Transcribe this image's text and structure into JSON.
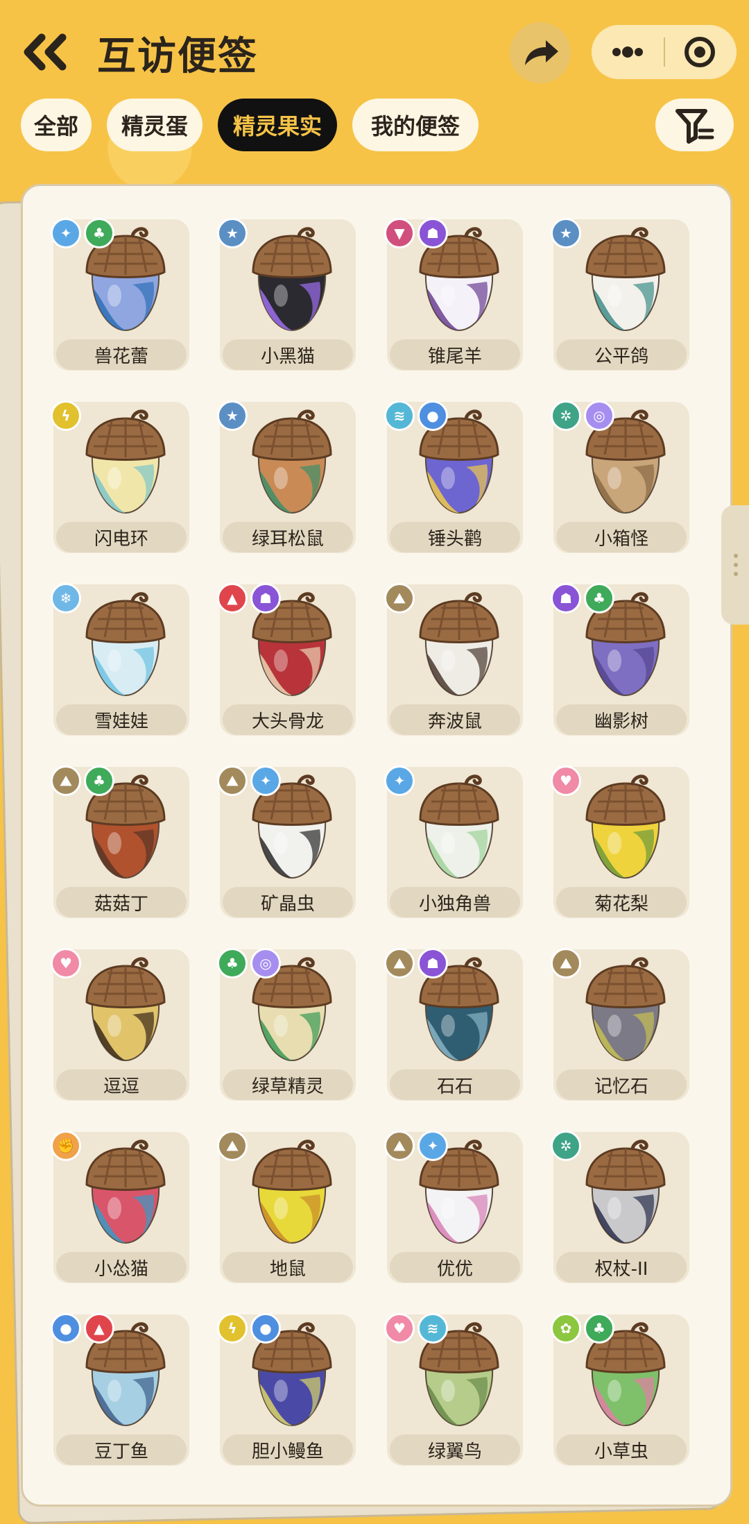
{
  "header": {
    "title": "互访便签",
    "back_icon": "double-chevron-left-icon",
    "share_icon": "share-arrow-icon",
    "more_icon": "more-dots-icon",
    "close_icon": "target-close-icon"
  },
  "tabs": [
    {
      "label": "全部",
      "active": false
    },
    {
      "label": "精灵蛋",
      "active": false
    },
    {
      "label": "精灵果实",
      "active": true
    },
    {
      "label": "我的便签",
      "active": false
    }
  ],
  "filter_icon": "filter-funnel-icon",
  "colors": {
    "background": "#f6c347",
    "active_tab_bg": "#111111",
    "active_tab_text": "#f6c347",
    "acorn_cap": "#9a6b42"
  },
  "fruits": [
    {
      "name": "兽花蕾",
      "types": [
        "ice",
        "grass"
      ],
      "body": [
        "#8fa6e0",
        "#2f6fb7"
      ]
    },
    {
      "name": "小黑猫",
      "types": [
        "normal"
      ],
      "body": [
        "#2a2a30",
        "#9e6ff0"
      ]
    },
    {
      "name": "锥尾羊",
      "types": [
        "demon",
        "ghost"
      ],
      "body": [
        "#f4f1f8",
        "#6b3f93"
      ]
    },
    {
      "name": "公平鸽",
      "types": [
        "normal"
      ],
      "body": [
        "#f3f1ec",
        "#3f8e8a"
      ]
    },
    {
      "name": "闪电环",
      "types": [
        "electric"
      ],
      "body": [
        "#f1e6a9",
        "#7ec6c9"
      ]
    },
    {
      "name": "绿耳松鼠",
      "types": [
        "normal"
      ],
      "body": [
        "#c98a55",
        "#3e8f6a"
      ]
    },
    {
      "name": "锤头鹳",
      "types": [
        "wing",
        "water"
      ],
      "body": [
        "#6d66d0",
        "#f0c94a"
      ]
    },
    {
      "name": "小箱怪",
      "types": [
        "mech",
        "illusion"
      ],
      "body": [
        "#c9a57a",
        "#8a6a44"
      ]
    },
    {
      "name": "雪娃娃",
      "types": [
        "frost"
      ],
      "body": [
        "#d8ecf3",
        "#6fc3e3"
      ]
    },
    {
      "name": "大头骨龙",
      "types": [
        "fire",
        "ghost"
      ],
      "body": [
        "#b8343a",
        "#e9d3b3"
      ]
    },
    {
      "name": "奔波鼠",
      "types": [
        "ground"
      ],
      "body": [
        "#efece6",
        "#4a3a30"
      ]
    },
    {
      "name": "幽影树",
      "types": [
        "ghost",
        "grass"
      ],
      "body": [
        "#7e6fc2",
        "#54468e"
      ]
    },
    {
      "name": "菇菇丁",
      "types": [
        "ground",
        "grass"
      ],
      "body": [
        "#b0522e",
        "#5a3526"
      ]
    },
    {
      "name": "矿晶虫",
      "types": [
        "ground",
        "ice"
      ],
      "body": [
        "#f1f1ee",
        "#2a2a2a"
      ]
    },
    {
      "name": "小独角兽",
      "types": [
        "ice"
      ],
      "body": [
        "#eef1ea",
        "#9fd39a"
      ]
    },
    {
      "name": "菊花梨",
      "types": [
        "cute"
      ],
      "body": [
        "#efd33d",
        "#6e9a3a"
      ]
    },
    {
      "name": "逗逗",
      "types": [
        "cute"
      ],
      "body": [
        "#e1c36a",
        "#3a2a1a"
      ]
    },
    {
      "name": "绿草精灵",
      "types": [
        "grass",
        "illusion"
      ],
      "body": [
        "#e7ddb0",
        "#3b9a56"
      ]
    },
    {
      "name": "石石",
      "types": [
        "ground",
        "ghost"
      ],
      "body": [
        "#2f5d72",
        "#86b3c4"
      ]
    },
    {
      "name": "记忆石",
      "types": [
        "ground"
      ],
      "body": [
        "#7c7a86",
        "#c6bf54"
      ]
    },
    {
      "name": "小怂猫",
      "types": [
        "warrior"
      ],
      "body": [
        "#d9556a",
        "#3a9ac5"
      ]
    },
    {
      "name": "地鼠",
      "types": [
        "ground"
      ],
      "body": [
        "#e8d93a",
        "#c98a2a"
      ]
    },
    {
      "name": "优优",
      "types": [
        "ground",
        "ice"
      ],
      "body": [
        "#f3f2f4",
        "#d77fb6"
      ]
    },
    {
      "name": "权杖-II",
      "types": [
        "mech"
      ],
      "body": [
        "#c9c9cc",
        "#2a2f4a"
      ]
    },
    {
      "name": "豆丁鱼",
      "types": [
        "water",
        "fire"
      ],
      "body": [
        "#a6cfe3",
        "#3f5f8a"
      ]
    },
    {
      "name": "胆小鳗鱼",
      "types": [
        "electric",
        "water"
      ],
      "body": [
        "#4a4aa6",
        "#d9d46a"
      ]
    },
    {
      "name": "绿翼鸟",
      "types": [
        "cute",
        "wing"
      ],
      "body": [
        "#b6cc8a",
        "#6a8a4a"
      ]
    },
    {
      "name": "小草虫",
      "types": [
        "bug",
        "grass"
      ],
      "body": [
        "#7fc06a",
        "#e27fa6"
      ]
    }
  ]
}
